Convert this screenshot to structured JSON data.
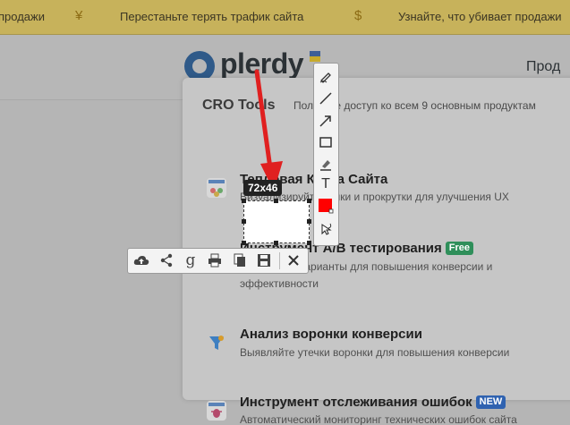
{
  "promo": {
    "text1": "продажи",
    "symbol1": "¥",
    "text2": "Перестаньте терять трафик сайта",
    "symbol2": "$",
    "text3": "Узнайте, что убивает продажи"
  },
  "header": {
    "logo": "plerdy",
    "nav_item": "Прод"
  },
  "dropdown": {
    "title": "CRO Tools",
    "subtitle": "Получите доступ ко всем 9 основным продуктам",
    "items": [
      {
        "title": "Тепловая Карта Сайта",
        "desc": "Визуализируйте клики и прокрутки для улучшения UX",
        "icon": "heatmap-icon"
      },
      {
        "title": "Инструмент A/B тестирования",
        "badge": "Free",
        "desc": "Тестируйте варианты для повышения конверсии и",
        "desc2": "эффективности",
        "icon": "ab-test-icon"
      },
      {
        "title": "Анализ воронки конверсии",
        "desc": "Выявляйте утечки воронки для повышения конверсии",
        "icon": "funnel-icon"
      },
      {
        "title": "Инструмент отслеживания ошибок",
        "badge": "NEW",
        "desc": "Автоматический мониторинг технических ошибок сайта",
        "icon": "bug-icon"
      }
    ]
  },
  "screenshot": {
    "size_label": "72x46",
    "vertical_tools": [
      "pen-icon",
      "line-icon",
      "arrow-icon",
      "rectangle-icon",
      "marker-icon",
      "text-icon",
      "color-picker-icon",
      "undo-icon"
    ],
    "horizontal_tools": [
      "upload-cloud-icon",
      "share-icon",
      "google-search-icon",
      "print-icon",
      "copy-icon",
      "save-icon",
      "close-icon"
    ],
    "color": "#ff0000"
  }
}
